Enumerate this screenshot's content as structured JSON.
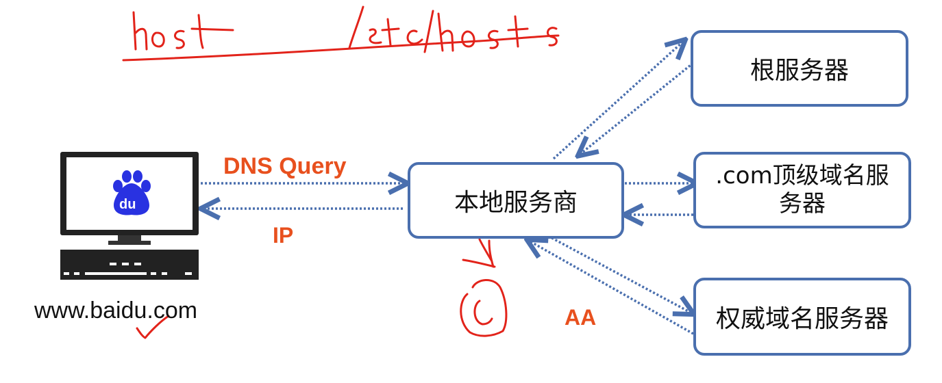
{
  "nodes": {
    "root": "根服务器",
    "local": "本地服务商",
    "tld_line1": ".com顶级域名服",
    "tld_line2": "务器",
    "auth": "权威域名服务器"
  },
  "client": {
    "logo_text": "du",
    "url": "www.baidu.com"
  },
  "labels": {
    "dns_query": "DNS Query",
    "ip": "IP",
    "aa": "AA"
  },
  "handwriting": {
    "annotation": "host /etc/hosts"
  },
  "colors": {
    "accent_blue": "#4a6fae",
    "label_orange": "#e8501e",
    "ink_red": "#e2231a",
    "baidu_blue": "#2932e1"
  }
}
